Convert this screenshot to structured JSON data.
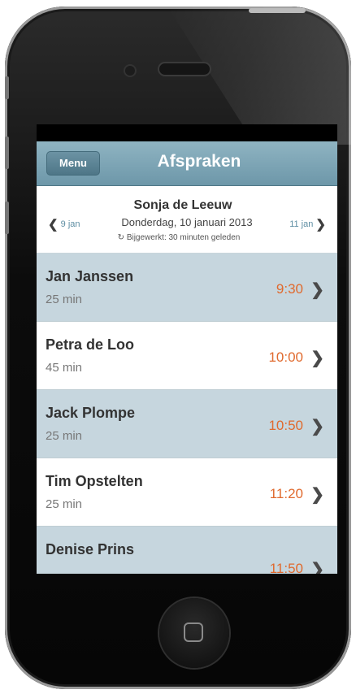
{
  "app": {
    "nav": {
      "menu_label": "Menu",
      "title": "Afspraken"
    },
    "header": {
      "prev_label": "9 jan",
      "next_label": "11 jan",
      "person": "Sonja de Leeuw",
      "date": "Donderdag, 10 januari 2013",
      "updated": "Bijgewerkt: 30 minuten geleden",
      "refresh_symbol": "↻",
      "chev_left": "❮",
      "chev_right": "❯"
    },
    "appointments": [
      {
        "name": "Jan Janssen",
        "duration": "25 min",
        "time": "9:30",
        "chevron": "❯"
      },
      {
        "name": "Petra de Loo",
        "duration": "45 min",
        "time": "10:00",
        "chevron": "❯"
      },
      {
        "name": "Jack Plompe",
        "duration": "25 min",
        "time": "10:50",
        "chevron": "❯"
      },
      {
        "name": "Tim Opstelten",
        "duration": "25 min",
        "time": "11:20",
        "chevron": "❯"
      },
      {
        "name": "Denise Prins",
        "duration": "",
        "time": "11:50",
        "chevron": "❯"
      }
    ]
  },
  "colors": {
    "accent": "#6d97a9",
    "time": "#e06a2e",
    "row_tint": "#c6d6de"
  }
}
